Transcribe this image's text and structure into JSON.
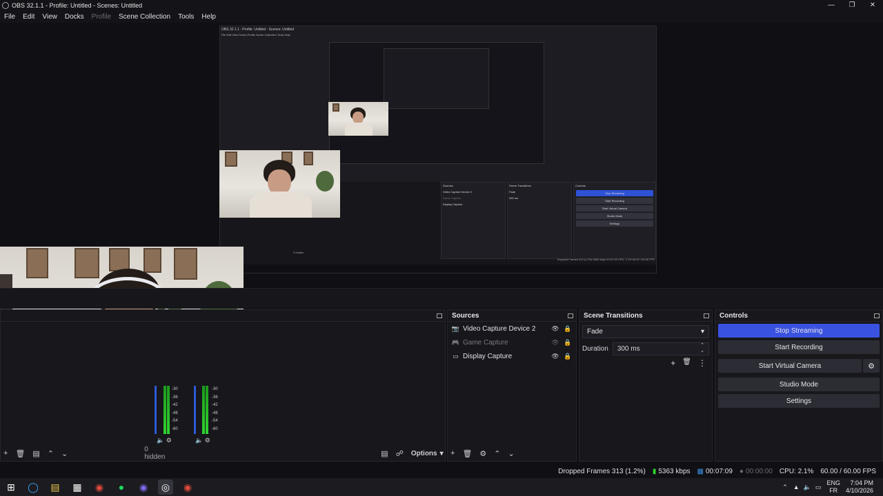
{
  "window": {
    "title": "OBS 32.1.1 - Profile: Untitled - Scenes: Untitled"
  },
  "menu": [
    "File",
    "Edit",
    "View",
    "Docks",
    "Profile",
    "Scene Collection",
    "Tools",
    "Help"
  ],
  "mini": {
    "title": "OBS 32.1.1 - Profile: Untitled - Scenes: Untitled",
    "menu": "File  Edit  View  Docks  Profile  Scene Collection  Tools  Help",
    "sources": [
      "Video Capture Device 2",
      "Game Capture",
      "Display Capture"
    ],
    "transition": "Fade",
    "duration": "300 ms",
    "buttons": [
      "Stop Streaming",
      "Start Recording",
      "Start Virtual Camera",
      "Studio Mode",
      "Settings"
    ],
    "hidden": "0 hidden",
    "status": "Dropped Frames 313 (1.2%)  5363 kbps  00:07:09  CPU: 2.1%  60.00 / 60.00 FPS"
  },
  "mixer": {
    "ticks": [
      "-30",
      "-36",
      "-42",
      "-48",
      "-54",
      "-60"
    ],
    "hidden_label": "0 hidden"
  },
  "sources": {
    "title": "Sources",
    "items": [
      {
        "label": "Video Capture Device 2",
        "icon": "camera-icon",
        "visible": true
      },
      {
        "label": "Game Capture",
        "icon": "gamepad-icon",
        "visible": false
      },
      {
        "label": "Display Capture",
        "icon": "monitor-icon",
        "visible": true
      }
    ]
  },
  "transitions": {
    "title": "Scene Transitions",
    "selected": "Fade",
    "duration_label": "Duration",
    "duration_value": "300 ms"
  },
  "controls": {
    "title": "Controls",
    "stop_streaming": "Stop Streaming",
    "start_recording": "Start Recording",
    "start_virtual_camera": "Start Virtual Camera",
    "studio_mode": "Studio Mode",
    "settings": "Settings"
  },
  "scenes_footer": {
    "options": "Options"
  },
  "status": {
    "dropped_frames": "Dropped Frames 313 (1.2%)",
    "bitrate": "5363 kbps",
    "stream_time": "00:07:09",
    "record_time": "00:00:00",
    "cpu": "CPU: 2.1%",
    "fps": "60.00 / 60.00 FPS"
  },
  "tray": {
    "lang1": "ENG",
    "lang2": "FR",
    "time": "7:04 PM",
    "date": "4/10/2026"
  },
  "colors": {
    "accent": "#3a52e0",
    "meter_green": "#2fd42f"
  }
}
